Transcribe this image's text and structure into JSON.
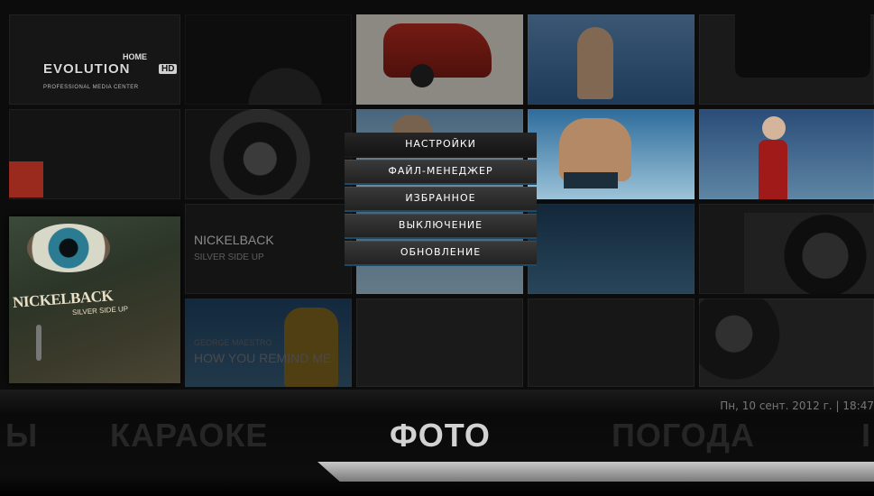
{
  "logo": {
    "main": "EVOLUTION",
    "top": "HOME",
    "badge": "HD",
    "sub": "PROFESSIONAL MEDIA CENTER"
  },
  "now_playing": {
    "artist": "NICKELBACK",
    "album": "SILVER SIDE UP",
    "prev_artist": "GEORGE MAESTRO",
    "prev_title": "HOW YOU REMIND ME",
    "cover_artist": "NICKELBACK",
    "cover_album": "SILVER SIDE UP"
  },
  "menu": {
    "items": [
      {
        "label": "НАСТРОЙКИ"
      },
      {
        "label": "ФАЙЛ-МЕНЕДЖЕР"
      },
      {
        "label": "ИЗБРАННОЕ"
      },
      {
        "label": "ВЫКЛЮЧЕНИЕ"
      },
      {
        "label": "ОБНОВЛЕНИЕ"
      }
    ]
  },
  "status": {
    "datetime": "Пн, 10 сент. 2012 г. | 18:47"
  },
  "nav": {
    "items": [
      {
        "label": "Ы"
      },
      {
        "label": "КАРАОКЕ"
      },
      {
        "label": "ФОТО"
      },
      {
        "label": "ПОГОДА"
      },
      {
        "label": "I"
      }
    ]
  },
  "colors": {
    "accent": "#1d4a66",
    "active_nav": "#d2d2d2",
    "inactive_nav": "#262626"
  }
}
